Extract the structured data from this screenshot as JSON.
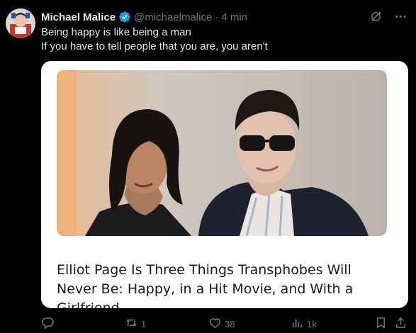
{
  "tweet": {
    "author_name": "Michael Malice",
    "handle": "@michaelmalice",
    "separator": "·",
    "timestamp": "4 min",
    "text_lines": [
      "Being happy is like being a man",
      "If you have to tell people that you are, you aren't"
    ],
    "card": {
      "headline": "Elliot Page Is Three Things Transphobes Will Never Be: Happy, in a Hit Movie, and With a Girlfriend"
    },
    "actions": {
      "reply_count": "",
      "retweet_count": "1",
      "like_count": "38",
      "view_count": "1k"
    }
  },
  "icons": {
    "verified": "verified-badge-icon",
    "grok": "grok-icon",
    "more": "more-icon",
    "reply": "reply-icon",
    "retweet": "retweet-icon",
    "like": "heart-icon",
    "views": "views-icon",
    "bookmark": "bookmark-icon",
    "share": "share-icon"
  },
  "colors": {
    "background": "#000000",
    "text": "#e7e9ea",
    "muted": "#71767b",
    "verified": "#1d9bf0",
    "card_background": "#ffffff"
  }
}
